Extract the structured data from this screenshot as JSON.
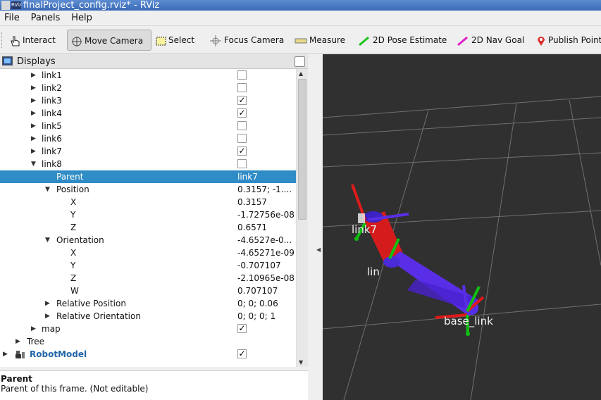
{
  "window": {
    "title": "finalProject_config.rviz* - RViz",
    "app_icon": "rviz-icon"
  },
  "menu": [
    "File",
    "Panels",
    "Help"
  ],
  "toolbar": {
    "interact": "Interact",
    "move_camera": "Move Camera",
    "select": "Select",
    "focus_camera": "Focus Camera",
    "measure": "Measure",
    "pose_estimate": "2D Pose Estimate",
    "nav_goal": "2D Nav Goal",
    "publish_point": "Publish Point"
  },
  "displays": {
    "title": "Displays",
    "rows": [
      {
        "name": "link1",
        "checked": false
      },
      {
        "name": "link2",
        "checked": false
      },
      {
        "name": "link3",
        "checked": true
      },
      {
        "name": "link4",
        "checked": true
      },
      {
        "name": "link5",
        "checked": false
      },
      {
        "name": "link6",
        "checked": false
      },
      {
        "name": "link7",
        "checked": true
      },
      {
        "name": "link8",
        "checked": false
      },
      {
        "name": "Parent",
        "value": "link7"
      },
      {
        "name": "Position",
        "value": "0.3157; -1...."
      },
      {
        "name": "X",
        "value": "0.3157"
      },
      {
        "name": "Y",
        "value": "-1.72756e-08"
      },
      {
        "name": "Z",
        "value": "0.6571"
      },
      {
        "name": "Orientation",
        "value": "-4.6527e-0..."
      },
      {
        "name": "X",
        "value": "-4.65271e-09"
      },
      {
        "name": "Y",
        "value": "-0.707107"
      },
      {
        "name": "Z",
        "value": "-2.10965e-08"
      },
      {
        "name": "W",
        "value": "0.707107"
      },
      {
        "name": "Relative Position",
        "value": "0; 0; 0.06"
      },
      {
        "name": "Relative Orientation",
        "value": "0; 0; 0; 1"
      },
      {
        "name": "map",
        "checked": true
      },
      {
        "name": "Tree"
      },
      {
        "name": "RobotModel",
        "checked": true
      }
    ]
  },
  "description": {
    "title": "Parent",
    "text": "Parent of this frame. (Not editable)"
  },
  "viewport": {
    "labels": {
      "link7": "link7",
      "link": "lin",
      "base_link": "base_link"
    }
  }
}
